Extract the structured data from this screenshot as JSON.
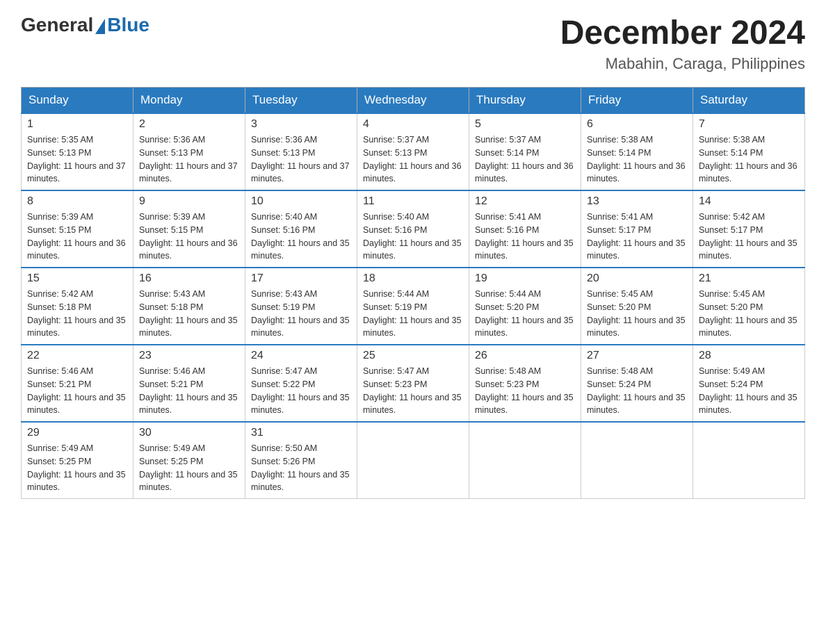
{
  "header": {
    "logo_general": "General",
    "logo_blue": "Blue",
    "month_year": "December 2024",
    "location": "Mabahin, Caraga, Philippines"
  },
  "days_of_week": [
    "Sunday",
    "Monday",
    "Tuesday",
    "Wednesday",
    "Thursday",
    "Friday",
    "Saturday"
  ],
  "weeks": [
    [
      {
        "day": "1",
        "sunrise": "Sunrise: 5:35 AM",
        "sunset": "Sunset: 5:13 PM",
        "daylight": "Daylight: 11 hours and 37 minutes."
      },
      {
        "day": "2",
        "sunrise": "Sunrise: 5:36 AM",
        "sunset": "Sunset: 5:13 PM",
        "daylight": "Daylight: 11 hours and 37 minutes."
      },
      {
        "day": "3",
        "sunrise": "Sunrise: 5:36 AM",
        "sunset": "Sunset: 5:13 PM",
        "daylight": "Daylight: 11 hours and 37 minutes."
      },
      {
        "day": "4",
        "sunrise": "Sunrise: 5:37 AM",
        "sunset": "Sunset: 5:13 PM",
        "daylight": "Daylight: 11 hours and 36 minutes."
      },
      {
        "day": "5",
        "sunrise": "Sunrise: 5:37 AM",
        "sunset": "Sunset: 5:14 PM",
        "daylight": "Daylight: 11 hours and 36 minutes."
      },
      {
        "day": "6",
        "sunrise": "Sunrise: 5:38 AM",
        "sunset": "Sunset: 5:14 PM",
        "daylight": "Daylight: 11 hours and 36 minutes."
      },
      {
        "day": "7",
        "sunrise": "Sunrise: 5:38 AM",
        "sunset": "Sunset: 5:14 PM",
        "daylight": "Daylight: 11 hours and 36 minutes."
      }
    ],
    [
      {
        "day": "8",
        "sunrise": "Sunrise: 5:39 AM",
        "sunset": "Sunset: 5:15 PM",
        "daylight": "Daylight: 11 hours and 36 minutes."
      },
      {
        "day": "9",
        "sunrise": "Sunrise: 5:39 AM",
        "sunset": "Sunset: 5:15 PM",
        "daylight": "Daylight: 11 hours and 36 minutes."
      },
      {
        "day": "10",
        "sunrise": "Sunrise: 5:40 AM",
        "sunset": "Sunset: 5:16 PM",
        "daylight": "Daylight: 11 hours and 35 minutes."
      },
      {
        "day": "11",
        "sunrise": "Sunrise: 5:40 AM",
        "sunset": "Sunset: 5:16 PM",
        "daylight": "Daylight: 11 hours and 35 minutes."
      },
      {
        "day": "12",
        "sunrise": "Sunrise: 5:41 AM",
        "sunset": "Sunset: 5:16 PM",
        "daylight": "Daylight: 11 hours and 35 minutes."
      },
      {
        "day": "13",
        "sunrise": "Sunrise: 5:41 AM",
        "sunset": "Sunset: 5:17 PM",
        "daylight": "Daylight: 11 hours and 35 minutes."
      },
      {
        "day": "14",
        "sunrise": "Sunrise: 5:42 AM",
        "sunset": "Sunset: 5:17 PM",
        "daylight": "Daylight: 11 hours and 35 minutes."
      }
    ],
    [
      {
        "day": "15",
        "sunrise": "Sunrise: 5:42 AM",
        "sunset": "Sunset: 5:18 PM",
        "daylight": "Daylight: 11 hours and 35 minutes."
      },
      {
        "day": "16",
        "sunrise": "Sunrise: 5:43 AM",
        "sunset": "Sunset: 5:18 PM",
        "daylight": "Daylight: 11 hours and 35 minutes."
      },
      {
        "day": "17",
        "sunrise": "Sunrise: 5:43 AM",
        "sunset": "Sunset: 5:19 PM",
        "daylight": "Daylight: 11 hours and 35 minutes."
      },
      {
        "day": "18",
        "sunrise": "Sunrise: 5:44 AM",
        "sunset": "Sunset: 5:19 PM",
        "daylight": "Daylight: 11 hours and 35 minutes."
      },
      {
        "day": "19",
        "sunrise": "Sunrise: 5:44 AM",
        "sunset": "Sunset: 5:20 PM",
        "daylight": "Daylight: 11 hours and 35 minutes."
      },
      {
        "day": "20",
        "sunrise": "Sunrise: 5:45 AM",
        "sunset": "Sunset: 5:20 PM",
        "daylight": "Daylight: 11 hours and 35 minutes."
      },
      {
        "day": "21",
        "sunrise": "Sunrise: 5:45 AM",
        "sunset": "Sunset: 5:20 PM",
        "daylight": "Daylight: 11 hours and 35 minutes."
      }
    ],
    [
      {
        "day": "22",
        "sunrise": "Sunrise: 5:46 AM",
        "sunset": "Sunset: 5:21 PM",
        "daylight": "Daylight: 11 hours and 35 minutes."
      },
      {
        "day": "23",
        "sunrise": "Sunrise: 5:46 AM",
        "sunset": "Sunset: 5:21 PM",
        "daylight": "Daylight: 11 hours and 35 minutes."
      },
      {
        "day": "24",
        "sunrise": "Sunrise: 5:47 AM",
        "sunset": "Sunset: 5:22 PM",
        "daylight": "Daylight: 11 hours and 35 minutes."
      },
      {
        "day": "25",
        "sunrise": "Sunrise: 5:47 AM",
        "sunset": "Sunset: 5:23 PM",
        "daylight": "Daylight: 11 hours and 35 minutes."
      },
      {
        "day": "26",
        "sunrise": "Sunrise: 5:48 AM",
        "sunset": "Sunset: 5:23 PM",
        "daylight": "Daylight: 11 hours and 35 minutes."
      },
      {
        "day": "27",
        "sunrise": "Sunrise: 5:48 AM",
        "sunset": "Sunset: 5:24 PM",
        "daylight": "Daylight: 11 hours and 35 minutes."
      },
      {
        "day": "28",
        "sunrise": "Sunrise: 5:49 AM",
        "sunset": "Sunset: 5:24 PM",
        "daylight": "Daylight: 11 hours and 35 minutes."
      }
    ],
    [
      {
        "day": "29",
        "sunrise": "Sunrise: 5:49 AM",
        "sunset": "Sunset: 5:25 PM",
        "daylight": "Daylight: 11 hours and 35 minutes."
      },
      {
        "day": "30",
        "sunrise": "Sunrise: 5:49 AM",
        "sunset": "Sunset: 5:25 PM",
        "daylight": "Daylight: 11 hours and 35 minutes."
      },
      {
        "day": "31",
        "sunrise": "Sunrise: 5:50 AM",
        "sunset": "Sunset: 5:26 PM",
        "daylight": "Daylight: 11 hours and 35 minutes."
      },
      null,
      null,
      null,
      null
    ]
  ]
}
